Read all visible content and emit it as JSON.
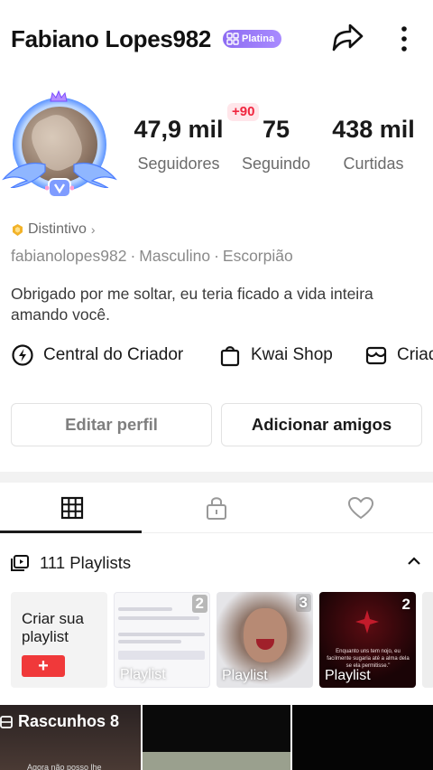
{
  "header": {
    "username": "Fabiano Lopes982",
    "badge_label": "Platina"
  },
  "stats": {
    "notification": "+90",
    "followers": {
      "value": "47,9 mil",
      "label": "Seguidores"
    },
    "following": {
      "value": "75",
      "label": "Seguindo"
    },
    "likes": {
      "value": "438 mil",
      "label": "Curtidas"
    }
  },
  "profile": {
    "distintivo": "Distintivo",
    "handle": "fabianolopes982",
    "gender": "Masculino",
    "sign": "Escorpião",
    "separator": "·",
    "bio": "Obrigado por me soltar, eu teria ficado a vida inteira amando você."
  },
  "links": {
    "creator_center": "Central do Criador",
    "shop": "Kwai Shop",
    "third": "Criad"
  },
  "buttons": {
    "edit": "Editar perfil",
    "add_friends": "Adicionar amigos"
  },
  "playlists": {
    "header": "111 Playlists",
    "create_label": "Criar sua playlist",
    "create_plus": "+",
    "cards": [
      {
        "count": "2",
        "label": "Playlist"
      },
      {
        "count": "3",
        "label": "Playlist"
      },
      {
        "count": "2",
        "label": "Playlist",
        "caption": "Enquanto uns tem nojo, eu facilmente sugaria até a alma dela se ela permitisse.\""
      }
    ]
  },
  "grid": {
    "drafts_label": "Rascunhos 8",
    "drafts_overlay": "Agora não posso lhe"
  },
  "colors": {
    "accent_red": "#f0393a",
    "badge_purple": "#8d6cf2",
    "notification_red": "#f0263f"
  }
}
